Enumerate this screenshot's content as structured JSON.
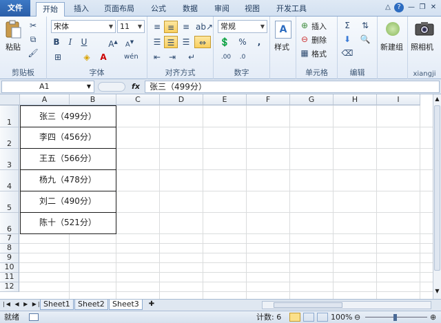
{
  "tabs": {
    "file": "文件",
    "home": "开始",
    "insert": "插入",
    "layout": "页面布局",
    "formulas": "公式",
    "data": "数据",
    "review": "审阅",
    "view": "视图",
    "developer": "开发工具"
  },
  "ribbon": {
    "clipboard": {
      "label": "剪贴板",
      "paste": "粘贴"
    },
    "font": {
      "label": "字体",
      "name": "宋体",
      "size": "11"
    },
    "alignment": {
      "label": "对齐方式"
    },
    "number": {
      "label": "数字",
      "format": "常规"
    },
    "styles": {
      "label": "样式"
    },
    "cells": {
      "label": "单元格",
      "insert": "插入",
      "delete": "删除",
      "format": "格式"
    },
    "editing": {
      "label": "编辑"
    },
    "newgroup": {
      "label": "新建组"
    },
    "camera": {
      "label": "照相机",
      "group": "xiangji"
    }
  },
  "formula_bar": {
    "cell": "A1",
    "fx": "fx",
    "value": "张三（499分）"
  },
  "columns": [
    "A",
    "B",
    "C",
    "D",
    "E",
    "F",
    "G",
    "H",
    "I"
  ],
  "rows": [
    "1",
    "2",
    "3",
    "4",
    "5",
    "6",
    "7",
    "8",
    "9",
    "10",
    "11",
    "12"
  ],
  "cells": [
    "张三（499分）",
    "李四（456分）",
    "王五（566分）",
    "杨九（478分）",
    "刘二（490分）",
    "陈十（521分）"
  ],
  "sheets": [
    "Sheet1",
    "Sheet2",
    "Sheet3"
  ],
  "status": {
    "mode": "就绪",
    "count": "计数: 6",
    "zoom": "100%"
  }
}
